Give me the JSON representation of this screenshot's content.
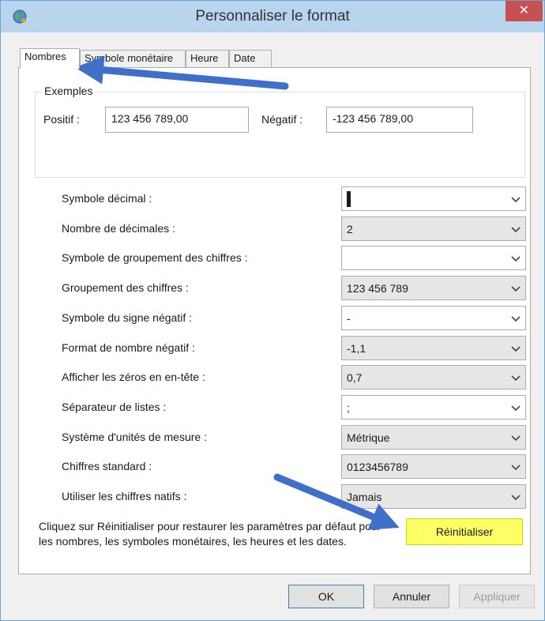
{
  "window": {
    "title": "Personnaliser le format",
    "close_symbol": "✕"
  },
  "tabs": [
    {
      "label": "Nombres",
      "active": true
    },
    {
      "label": "Symbole monétaire",
      "active": false
    },
    {
      "label": "Heure",
      "active": false
    },
    {
      "label": "Date",
      "active": false
    }
  ],
  "examples": {
    "group_label": "Exemples",
    "positive_label": "Positif :",
    "positive_value": "123 456 789,00",
    "negative_label": "Négatif :",
    "negative_value": "-123 456 789,00"
  },
  "settings": [
    {
      "label": "Symbole décimal :",
      "value": ""
    },
    {
      "label": "Nombre de décimales :",
      "value": "2"
    },
    {
      "label": "Symbole de groupement des chiffres :",
      "value": ""
    },
    {
      "label": "Groupement des chiffres :",
      "value": "123 456 789"
    },
    {
      "label": "Symbole du signe négatif :",
      "value": "-"
    },
    {
      "label": "Format de nombre négatif :",
      "value": "-1,1"
    },
    {
      "label": "Afficher les zéros en en-tête :",
      "value": "0,7"
    },
    {
      "label": "Séparateur de listes :",
      "value": ";"
    },
    {
      "label": "Système d'unités de mesure :",
      "value": "Métrique"
    },
    {
      "label": "Chiffres standard :",
      "value": "0123456789"
    },
    {
      "label": "Utiliser les chiffres natifs :",
      "value": "Jamais"
    }
  ],
  "info_text": "Cliquez sur Réinitialiser pour restaurer les paramètres par défaut pour les nombres, les symboles monétaires, les heures et les dates.",
  "buttons": {
    "reset": "Réinitialiser",
    "ok": "OK",
    "cancel": "Annuler",
    "apply": "Appliquer"
  },
  "colors": {
    "titlebar": "#b9d5ee",
    "close": "#c75050",
    "highlight": "#ffff66",
    "annotation_arrow": "#3f6fc8"
  }
}
